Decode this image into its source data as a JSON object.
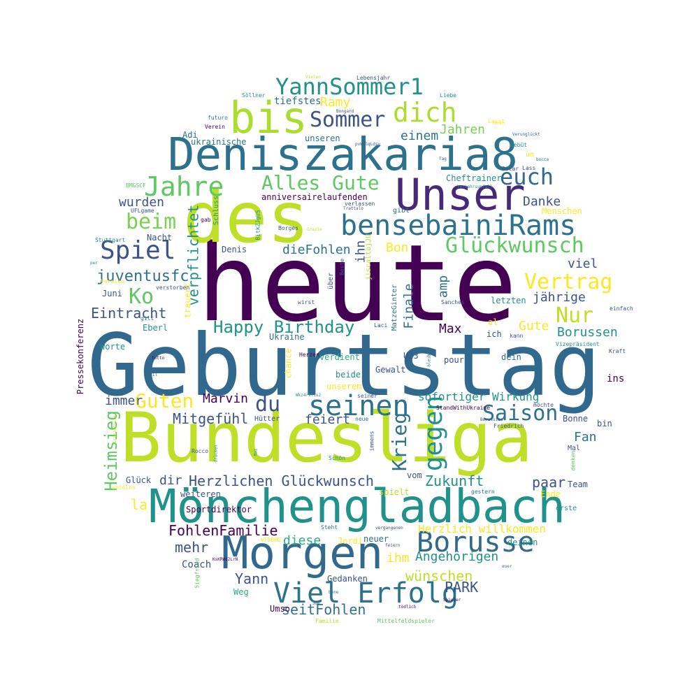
{
  "palette": {
    "dark_purple": "#440154",
    "indigo": "#3b528b",
    "blue": "#2c728e",
    "teal": "#21918c",
    "green": "#28ae80",
    "light_green": "#5ec962",
    "lime": "#addc30",
    "yellow": "#fde725"
  },
  "words": [
    {
      "text": "heute",
      "color": "#440154",
      "vertical": false
    },
    {
      "text": "Geburtstag",
      "color": "#31688e",
      "vertical": false
    },
    {
      "text": "Bundesliga",
      "color": "#bddf26",
      "vertical": false
    },
    {
      "text": "des",
      "color": "#bddf26",
      "vertical": false
    },
    {
      "text": "Deniszakaria8",
      "color": "#2c728e",
      "vertical": false
    },
    {
      "text": "Unser",
      "color": "#482878",
      "vertical": false
    },
    {
      "text": "Mönchengladbach",
      "color": "#21918c",
      "vertical": false
    },
    {
      "text": "Morgen",
      "color": "#31688e",
      "vertical": false
    },
    {
      "text": "bis",
      "color": "#addc30",
      "vertical": false
    },
    {
      "text": "bensebainiRams",
      "color": "#2c728e",
      "vertical": false
    },
    {
      "text": "Borusse",
      "color": "#31688e",
      "vertical": false
    },
    {
      "text": "seinen",
      "color": "#2c728e",
      "vertical": false
    },
    {
      "text": "Viel Erfolg",
      "color": "#2c728e",
      "vertical": false
    },
    {
      "text": "Jahre",
      "color": "#5ec962",
      "vertical": false
    },
    {
      "text": "Spiel",
      "color": "#3b528b",
      "vertical": false
    },
    {
      "text": "YannSommer1",
      "color": "#21918c",
      "vertical": false
    },
    {
      "text": "dich",
      "color": "#addc30",
      "vertical": false
    },
    {
      "text": "Sommer",
      "color": "#3b528b",
      "vertical": false
    },
    {
      "text": "Alles Gute",
      "color": "#5ec962",
      "vertical": false
    },
    {
      "text": "euch",
      "color": "#31688e",
      "vertical": false
    },
    {
      "text": "Glückwunsch",
      "color": "#5ec962",
      "vertical": false
    },
    {
      "text": "beim",
      "color": "#7ad151",
      "vertical": false
    },
    {
      "text": "Vertrag",
      "color": "#fde725",
      "vertical": false
    },
    {
      "text": "Nur",
      "color": "#bddf26",
      "vertical": false
    },
    {
      "text": "Ko",
      "color": "#5ec962",
      "vertical": false
    },
    {
      "text": "Saison",
      "color": "#2c728e",
      "vertical": false
    },
    {
      "text": "du",
      "color": "#3b528b",
      "vertical": false
    },
    {
      "text": "Guten",
      "color": "#fde725",
      "vertical": false
    },
    {
      "text": "Happy Birthday",
      "color": "#21918c",
      "vertical": false
    },
    {
      "text": "Herzlichen Glückwunsch",
      "color": "#3b528b",
      "vertical": false
    },
    {
      "text": "gegen",
      "color": "#21918c",
      "vertical": true
    },
    {
      "text": "Krieg",
      "color": "#2c728e",
      "vertical": true
    },
    {
      "text": "Heimsieg",
      "color": "#5ec962",
      "vertical": true
    },
    {
      "text": "verpflichtet",
      "color": "#21918c",
      "vertical": true
    },
    {
      "text": "juventusfc",
      "color": "#2c728e",
      "vertical": false
    },
    {
      "text": "Eintracht",
      "color": "#3b528b",
      "vertical": false
    },
    {
      "text": "Mitgefühl",
      "color": "#3b528b",
      "vertical": false
    },
    {
      "text": "Marvin",
      "color": "#440154",
      "vertical": false
    },
    {
      "text": "feiert",
      "color": "#3b528b",
      "vertical": false
    },
    {
      "text": "Zukunft",
      "color": "#21918c",
      "vertical": false
    },
    {
      "text": "FohlenFamilie",
      "color": "#440154",
      "vertical": false
    },
    {
      "text": "Angehörigen",
      "color": "#21918c",
      "vertical": false
    },
    {
      "text": "wünschen",
      "color": "#bddf26",
      "vertical": false
    },
    {
      "text": "seitFohlen",
      "color": "#2c728e",
      "vertical": false
    },
    {
      "text": "Yann",
      "color": "#3b528b",
      "vertical": false
    },
    {
      "text": "mehr",
      "color": "#3b528b",
      "vertical": false
    },
    {
      "text": "diese",
      "color": "#28ae80",
      "vertical": false
    },
    {
      "text": "ihm",
      "color": "#fde725",
      "vertical": false
    },
    {
      "text": "PARK",
      "color": "#3b528b",
      "vertical": false
    },
    {
      "text": "Ramy",
      "color": "#fde725",
      "vertical": false
    },
    {
      "text": "Jahren",
      "color": "#7ad151",
      "vertical": false
    },
    {
      "text": "einem",
      "color": "#2c728e",
      "vertical": false
    },
    {
      "text": "wurden",
      "color": "#3b528b",
      "vertical": false
    },
    {
      "text": "Danke",
      "color": "#3b528b",
      "vertical": false
    },
    {
      "text": "Bon",
      "color": "#fde725",
      "vertical": false
    },
    {
      "text": "dieFohlen",
      "color": "#2c728e",
      "vertical": false
    },
    {
      "text": "ihn",
      "color": "#3b528b",
      "vertical": true
    },
    {
      "text": "amp",
      "color": "#2c728e",
      "vertical": true
    },
    {
      "text": "Finale",
      "color": "#2c728e",
      "vertical": true
    },
    {
      "text": "viel",
      "color": "#3b528b",
      "vertical": false
    },
    {
      "text": "jährige",
      "color": "#3b528b",
      "vertical": false
    },
    {
      "text": "Max",
      "color": "#440154",
      "vertical": false
    },
    {
      "text": "Gute",
      "color": "#fde725",
      "vertical": false
    },
    {
      "text": "Borussen",
      "color": "#21918c",
      "vertical": false
    },
    {
      "text": "sofortiger Wirkung",
      "color": "#21918c",
      "vertical": false
    },
    {
      "text": "paar",
      "color": "#3b528b",
      "vertical": false
    },
    {
      "text": "Fan",
      "color": "#2c728e",
      "vertical": false
    },
    {
      "text": "dir",
      "color": "#3b528b",
      "vertical": false
    },
    {
      "text": "la",
      "color": "#fde725",
      "vertical": false
    },
    {
      "text": "immer",
      "color": "#3b528b",
      "vertical": false
    },
    {
      "text": "Herzlich willkommen",
      "color": "#fde725",
      "vertical": false
    },
    {
      "text": "tiefstes",
      "color": "#2c728e",
      "vertical": false
    },
    {
      "text": "ukrainische",
      "color": "#2c728e",
      "vertical": false
    },
    {
      "text": "unseren",
      "color": "#2c728e",
      "vertical": false
    },
    {
      "text": "anniversairelaufenden",
      "color": "#440154",
      "vertical": false
    },
    {
      "text": "Cheftrainer",
      "color": "#21918c",
      "vertical": false
    },
    {
      "text": "gibt",
      "color": "#2c728e",
      "vertical": false
    },
    {
      "text": "Menschen",
      "color": "#fde725",
      "vertical": false
    },
    {
      "text": "Denis",
      "color": "#3b528b",
      "vertical": false
    },
    {
      "text": "Nacht",
      "color": "#3b528b",
      "vertical": false
    },
    {
      "text": "Juni",
      "color": "#3b528b",
      "vertical": false
    },
    {
      "text": "Eberl",
      "color": "#21918c",
      "vertical": false
    },
    {
      "text": "Worte",
      "color": "#21918c",
      "vertical": false
    },
    {
      "text": "Ukraine",
      "color": "#2c728e",
      "vertical": false
    },
    {
      "text": "verdient",
      "color": "#28ae80",
      "vertical": false
    },
    {
      "text": "U23",
      "color": "#3b528b",
      "vertical": false
    },
    {
      "text": "Gewalt",
      "color": "#3b528b",
      "vertical": false
    },
    {
      "text": "beide",
      "color": "#21918c",
      "vertical": false
    },
    {
      "text": "unserem",
      "color": "#fde725",
      "vertical": false
    },
    {
      "text": "pour",
      "color": "#3b528b",
      "vertical": false
    },
    {
      "text": "dein",
      "color": "#2c728e",
      "vertical": false
    },
    {
      "text": "letzten",
      "color": "#21918c",
      "vertical": false
    },
    {
      "text": "ich",
      "color": "#3b528b",
      "vertical": false
    },
    {
      "text": "al",
      "color": "#fde725",
      "vertical": false
    },
    {
      "text": "ins",
      "color": "#440154",
      "vertical": false
    },
    {
      "text": "Bonne",
      "color": "#3b528b",
      "vertical": false
    },
    {
      "text": "bin",
      "color": "#3b528b",
      "vertical": false
    },
    {
      "text": "Mal",
      "color": "#3b528b",
      "vertical": false
    },
    {
      "text": "Team",
      "color": "#3b528b",
      "vertical": false
    },
    {
      "text": "Ende",
      "color": "#fde725",
      "vertical": false
    },
    {
      "text": "erste",
      "color": "#21918c",
      "vertical": false
    },
    {
      "text": "deinen",
      "color": "#21918c",
      "vertical": false
    },
    {
      "text": "vom",
      "color": "#3b528b",
      "vertical": false
    },
    {
      "text": "spielt",
      "color": "#bddf26",
      "vertical": false
    },
    {
      "text": "weiteren",
      "color": "#3b528b",
      "vertical": false
    },
    {
      "text": "Sportdirektor",
      "color": "#440154",
      "vertical": false
    },
    {
      "text": "Glück",
      "color": "#3b528b",
      "vertical": false
    },
    {
      "text": "Hütter",
      "color": "#3b528b",
      "vertical": false
    },
    {
      "text": "Coach",
      "color": "#3b528b",
      "vertical": false
    },
    {
      "text": "Gedanken",
      "color": "#3b528b",
      "vertical": false
    },
    {
      "text": "Umso",
      "color": "#440154",
      "vertical": false
    },
    {
      "text": "Weg",
      "color": "#28ae80",
      "vertical": false
    },
    {
      "text": "neuer",
      "color": "#2c728e",
      "vertical": false
    },
    {
      "text": "Jordi",
      "color": "#fde725",
      "vertical": false
    },
    {
      "text": "Pressekonferenz",
      "color": "#440154",
      "vertical": true
    },
    {
      "text": "chance",
      "color": "#fde725",
      "vertical": true
    },
    {
      "text": "trauert",
      "color": "#fde725",
      "vertical": true
    },
    {
      "text": "MatzeGinter",
      "color": "#2c728e",
      "vertical": true
    },
    {
      "text": "über",
      "color": "#3b528b",
      "vertical": true
    },
    {
      "text": "Lebensjahr",
      "color": "#3b528b",
      "vertical": false
    },
    {
      "text": "Vielen",
      "color": "#bddf26",
      "vertical": false
    },
    {
      "text": "Söllner",
      "color": "#21918c",
      "vertical": false
    },
    {
      "text": "Liebe",
      "color": "#21918c",
      "vertical": false
    },
    {
      "text": "Bongard",
      "color": "#3b528b",
      "vertical": false
    },
    {
      "text": "futuro",
      "color": "#2c728e",
      "vertical": false
    },
    {
      "text": "Verein",
      "color": "#440154",
      "vertical": false
    },
    {
      "text": "Adi",
      "color": "#2c728e",
      "vertical": false
    },
    {
      "text": "Lasst",
      "color": "#fde725",
      "vertical": false
    },
    {
      "text": "ihnen",
      "color": "#fde725",
      "vertical": false
    },
    {
      "text": "Verunglückt",
      "color": "#2c728e",
      "vertical": false
    },
    {
      "text": "pvWtlqLdsy",
      "color": "#3b528b",
      "vertical": false
    },
    {
      "text": "Debüt",
      "color": "#21918c",
      "vertical": false
    },
    {
      "text": "um",
      "color": "#fde725",
      "vertical": false
    },
    {
      "text": "bocca",
      "color": "#2c728e",
      "vertical": false
    },
    {
      "text": "Tag",
      "color": "#3b528b",
      "vertical": false
    },
    {
      "text": "Oscar",
      "color": "#3b528b",
      "vertical": false
    },
    {
      "text": "Lass",
      "color": "#3b528b",
      "vertical": false
    },
    {
      "text": "BMGSCF",
      "color": "#5ec962",
      "vertical": false
    },
    {
      "text": "Verkehrsunfall",
      "color": "#21918c",
      "vertical": false
    },
    {
      "text": "UFLgame",
      "color": "#3b528b",
      "vertical": false
    },
    {
      "text": "verlassen",
      "color": "#3b528b",
      "vertical": false
    },
    {
      "text": "Trattalo",
      "color": "#3b528b",
      "vertical": false
    },
    {
      "text": "gab",
      "color": "#440154",
      "vertical": false
    },
    {
      "text": "Schluss",
      "color": "#21918c",
      "vertical": true
    },
    {
      "text": "Stuttgart",
      "color": "#21918c",
      "vertical": false
    },
    {
      "text": "Borges",
      "color": "#3b528b",
      "vertical": false
    },
    {
      "text": "Grazie",
      "color": "#bddf26",
      "vertical": false
    },
    {
      "text": "BitkZJgUS",
      "color": "#21918c",
      "vertical": true
    },
    {
      "text": "jiscaltojJU",
      "color": "#bddf26",
      "vertical": true
    },
    {
      "text": "Beste",
      "color": "#3b528b",
      "vertical": true
    },
    {
      "text": "per",
      "color": "#21918c",
      "vertical": false
    },
    {
      "text": "Vereine",
      "color": "#fde725",
      "vertical": false
    },
    {
      "text": "verstorben",
      "color": "#3b528b",
      "vertical": false
    },
    {
      "text": "wirst",
      "color": "#3b528b",
      "vertical": false
    },
    {
      "text": "Sanches",
      "color": "#3b528b",
      "vertical": false
    },
    {
      "text": "einfach",
      "color": "#3b528b",
      "vertical": false
    },
    {
      "text": "gilt",
      "color": "#2c728e",
      "vertical": false
    },
    {
      "text": "Laci",
      "color": "#3b528b",
      "vertical": false
    },
    {
      "text": "kann",
      "color": "#3b528b",
      "vertical": false
    },
    {
      "text": "Vizepräsident",
      "color": "#21918c",
      "vertical": false
    },
    {
      "text": "Kraft",
      "color": "#3b528b",
      "vertical": false
    },
    {
      "text": "tutto",
      "color": "#440154",
      "vertical": false
    },
    {
      "text": "Herzen",
      "color": "#440154",
      "vertical": false
    },
    {
      "text": "bleiben",
      "color": "#2c728e",
      "vertical": true
    },
    {
      "text": "il",
      "color": "#3b528b",
      "vertical": false
    },
    {
      "text": "Wkz4r9lix2",
      "color": "#21918c",
      "vertical": false
    },
    {
      "text": "seiner",
      "color": "#3b528b",
      "vertical": false
    },
    {
      "text": "StandWithUkraine",
      "color": "#440154",
      "vertical": false
    },
    {
      "text": "möchte",
      "color": "#3b528b",
      "vertical": false
    },
    {
      "text": "neue",
      "color": "#2c728e",
      "vertical": false
    },
    {
      "text": "Friedrich",
      "color": "#3b528b",
      "vertical": false
    },
    {
      "text": "Borussias",
      "color": "#3b528b",
      "vertical": false
    },
    {
      "text": "Grazie2mila",
      "color": "#bddf26",
      "vertical": true
    },
    {
      "text": "immens",
      "color": "#3b528b",
      "vertical": true
    },
    {
      "text": "Schön",
      "color": "#21918c",
      "vertical": false
    },
    {
      "text": "Rocco",
      "color": "#3b528b",
      "vertical": false
    },
    {
      "text": "Mai",
      "color": "#21918c",
      "vertical": true
    },
    {
      "text": "drücken",
      "color": "#21918c",
      "vertical": true
    },
    {
      "text": "denken",
      "color": "#5ec962",
      "vertical": true
    },
    {
      "text": "spielen",
      "color": "#fde725",
      "vertical": false
    },
    {
      "text": "gestern",
      "color": "#2c728e",
      "vertical": false
    },
    {
      "text": "Steht",
      "color": "#2c728e",
      "vertical": false
    },
    {
      "text": "vergangenen",
      "color": "#3b528b",
      "vertical": false
    },
    {
      "text": "VFBBMG",
      "color": "#fde725",
      "vertical": false
    },
    {
      "text": "feiern",
      "color": "#3b528b",
      "vertical": false
    },
    {
      "text": "KsKRWd2LrN",
      "color": "#440154",
      "vertical": false
    },
    {
      "text": "Siegfried",
      "color": "#5ec962",
      "vertical": true
    },
    {
      "text": "euer",
      "color": "#2c728e",
      "vertical": false
    },
    {
      "text": "bene",
      "color": "#2c728e",
      "vertical": false
    },
    {
      "text": "Spieler",
      "color": "#440154",
      "vertical": false
    },
    {
      "text": "tödlich",
      "color": "#440154",
      "vertical": false
    },
    {
      "text": "Familie",
      "color": "#bddf26",
      "vertical": false
    },
    {
      "text": "Mittelfeldspieler",
      "color": "#5ec962",
      "vertical": false
    },
    {
      "text": "Joe",
      "color": "#3b528b",
      "vertical": false
    },
    {
      "text": "lupo",
      "color": "#fde725",
      "vertical": true
    }
  ]
}
